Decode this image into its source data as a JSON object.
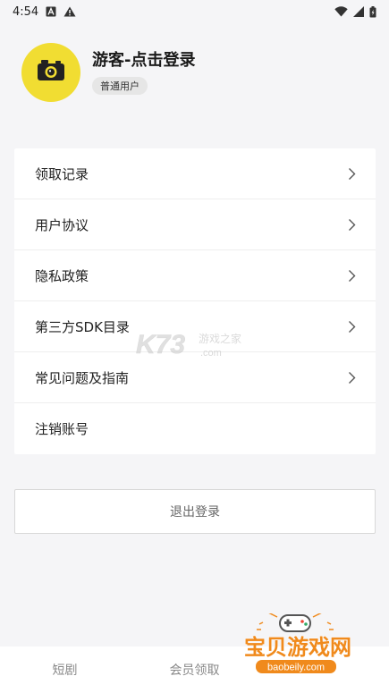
{
  "status_bar": {
    "time": "4:54",
    "icons": [
      "notification-a-icon",
      "warning-icon",
      "wifi-icon",
      "signal-icon",
      "battery-icon"
    ]
  },
  "profile": {
    "username": "游客-点击登录",
    "badge": "普通用户",
    "avatar_icon": "camera-icon"
  },
  "menu": {
    "items": [
      {
        "label": "领取记录",
        "chevron": true
      },
      {
        "label": "用户协议",
        "chevron": true
      },
      {
        "label": "隐私政策",
        "chevron": true
      },
      {
        "label": "第三方SDK目录",
        "chevron": true
      },
      {
        "label": "常见问题及指南",
        "chevron": true
      },
      {
        "label": "注销账号",
        "chevron": false
      }
    ]
  },
  "logout": {
    "label": "退出登录"
  },
  "watermarks": {
    "k73_main": "K73",
    "k73_sub": "游戏之家",
    "k73_domain": ".com",
    "baobei_main": "宝贝游戏网",
    "baobei_url": "baobeily.com"
  },
  "bottom_nav": {
    "items": [
      {
        "label": "短剧"
      },
      {
        "label": "会员领取"
      },
      {
        "label": ""
      }
    ]
  },
  "colors": {
    "background": "#f5f5f7",
    "avatar_yellow": "#f1dd32",
    "badge_bg": "#e6e6e6",
    "watermark_orange": "#f08a1c"
  }
}
